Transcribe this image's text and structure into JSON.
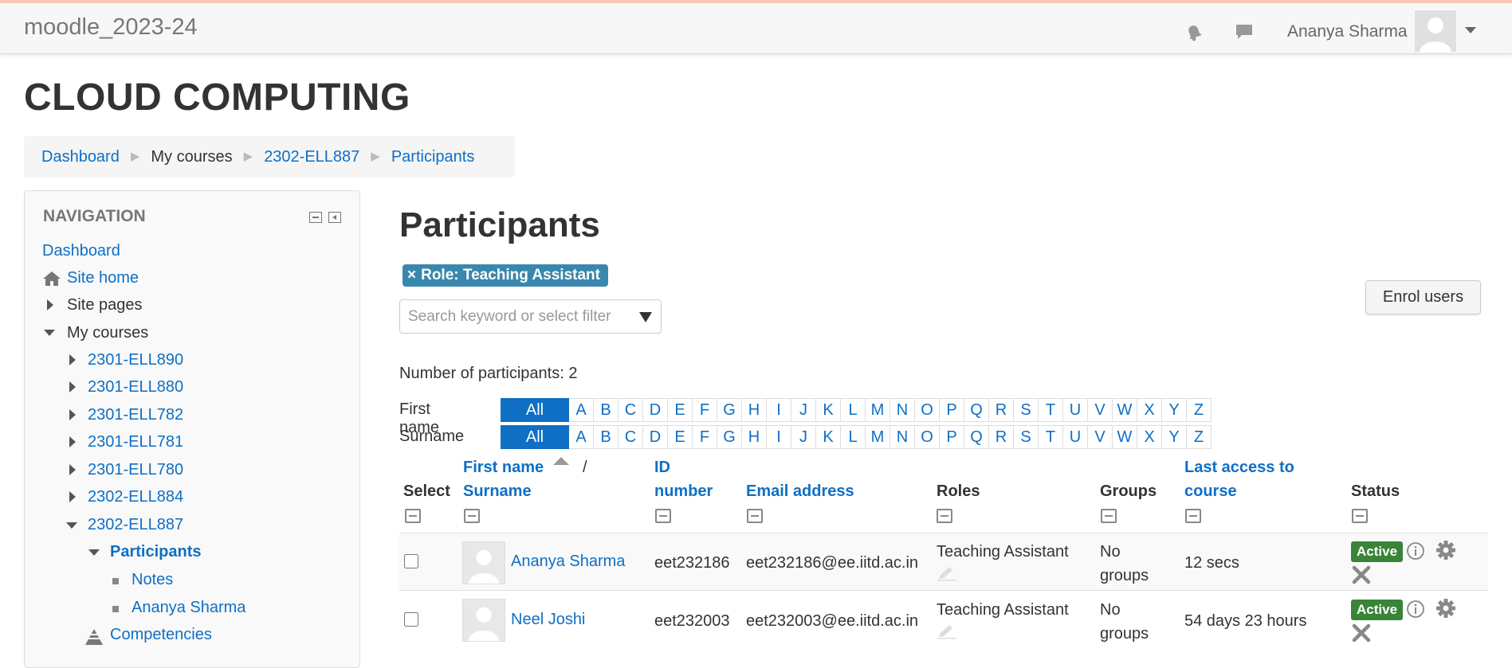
{
  "topbar": {
    "site_name": "moodle_2023-24",
    "user_name": "Ananya Sharma",
    "icons": [
      "bell-icon",
      "chat-icon",
      "avatar",
      "chevron-down-icon"
    ]
  },
  "course_title": "CLOUD COMPUTING",
  "breadcrumb": [
    "Dashboard",
    "My courses",
    "2302-ELL887",
    "Participants"
  ],
  "navigation": {
    "heading": "NAVIGATION",
    "items": [
      {
        "label": "Dashboard",
        "kind": "link"
      },
      {
        "label": "Site home",
        "kind": "link",
        "icon": "home-icon"
      },
      {
        "label": "Site pages",
        "kind": "collapsed"
      },
      {
        "label": "My courses",
        "kind": "expanded"
      },
      {
        "label": "2301-ELL890",
        "kind": "collapsed-link"
      },
      {
        "label": "2301-ELL880",
        "kind": "collapsed-link"
      },
      {
        "label": "2301-ELL782",
        "kind": "collapsed-link"
      },
      {
        "label": "2301-ELL781",
        "kind": "collapsed-link"
      },
      {
        "label": "2301-ELL780",
        "kind": "collapsed-link"
      },
      {
        "label": "2302-ELL884",
        "kind": "collapsed-link"
      },
      {
        "label": "2302-ELL887",
        "kind": "expanded-link"
      },
      {
        "label": "Participants",
        "kind": "expanded-current"
      },
      {
        "label": "Notes",
        "kind": "bullet-link"
      },
      {
        "label": "Ananya Sharma",
        "kind": "bullet-link"
      },
      {
        "label": "Competencies",
        "kind": "link",
        "icon": "competencies-icon"
      }
    ]
  },
  "main": {
    "heading": "Participants",
    "filter_chip": "Role: Teaching Assistant",
    "filter_chip_close": "×",
    "search_placeholder": "Search keyword or select filter",
    "enrol_button": "Enrol users",
    "participant_count": "Number of participants: 2",
    "initials": {
      "first_name_label": "First name",
      "surname_label": "Surname",
      "all": "All",
      "letters": [
        "A",
        "B",
        "C",
        "D",
        "E",
        "F",
        "G",
        "H",
        "I",
        "J",
        "K",
        "L",
        "M",
        "N",
        "O",
        "P",
        "Q",
        "R",
        "S",
        "T",
        "U",
        "V",
        "W",
        "X",
        "Y",
        "Z"
      ]
    },
    "table": {
      "headers": {
        "select": "Select",
        "first_name": "First name",
        "slash": "/",
        "surname": "Surname",
        "id_line1": "ID",
        "id_line2": "number",
        "email": "Email address",
        "roles": "Roles",
        "groups": "Groups",
        "last_access_line1": "Last access to",
        "last_access_line2": "course",
        "status": "Status"
      },
      "rows": [
        {
          "name": "Ananya Sharma",
          "id": "eet232186",
          "email": "eet232186@ee.iitd.ac.in",
          "role": "Teaching Assistant",
          "groups_line1": "No",
          "groups_line2": "groups",
          "last_access": "12 secs",
          "status": "Active"
        },
        {
          "name": "Neel Joshi",
          "id": "eet232003",
          "email": "eet232003@ee.iitd.ac.in",
          "role": "Teaching Assistant",
          "groups_line1": "No",
          "groups_line2": "groups",
          "last_access": "54 days 23 hours",
          "status": "Active"
        }
      ]
    }
  },
  "colors": {
    "link": "#0f6fc5",
    "chip": "#3a87ad",
    "active_badge": "#398439",
    "topbar_accent": "#f8c6b4"
  }
}
